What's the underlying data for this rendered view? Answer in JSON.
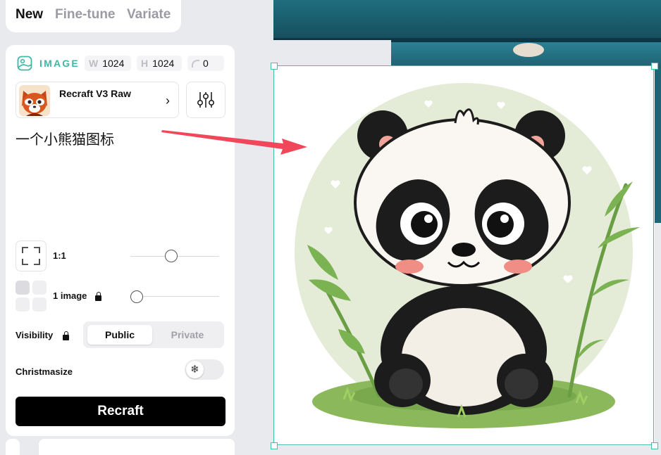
{
  "tabs": [
    {
      "label": "New",
      "active": true
    },
    {
      "label": "Fine-tune",
      "active": false
    },
    {
      "label": "Variate",
      "active": false
    }
  ],
  "image_settings": {
    "section_label": "IMAGE",
    "width_key": "W",
    "width": "1024",
    "height_key": "H",
    "height": "1024",
    "radius": "0"
  },
  "model": {
    "name": "Recraft V3 Raw",
    "icon": "red-panda-avatar"
  },
  "prompt": "一个小熊猫图标",
  "aspect_ratio": {
    "label": "1:1",
    "slider_value": 0.45
  },
  "image_count": {
    "label": "1 image",
    "slider_value": 0.0,
    "locked": true
  },
  "visibility": {
    "label": "Visibility",
    "locked": true,
    "options": [
      "Public",
      "Private"
    ],
    "selected": "Public"
  },
  "christmasize": {
    "label": "Christmasize",
    "enabled": false,
    "icon": "snowflake-icon"
  },
  "generate_button": {
    "label": "Recraft"
  },
  "colors": {
    "accent": "#3fb8a6",
    "selection": "#43c0ad",
    "arrow": "#f0475a",
    "button": "#000000"
  }
}
